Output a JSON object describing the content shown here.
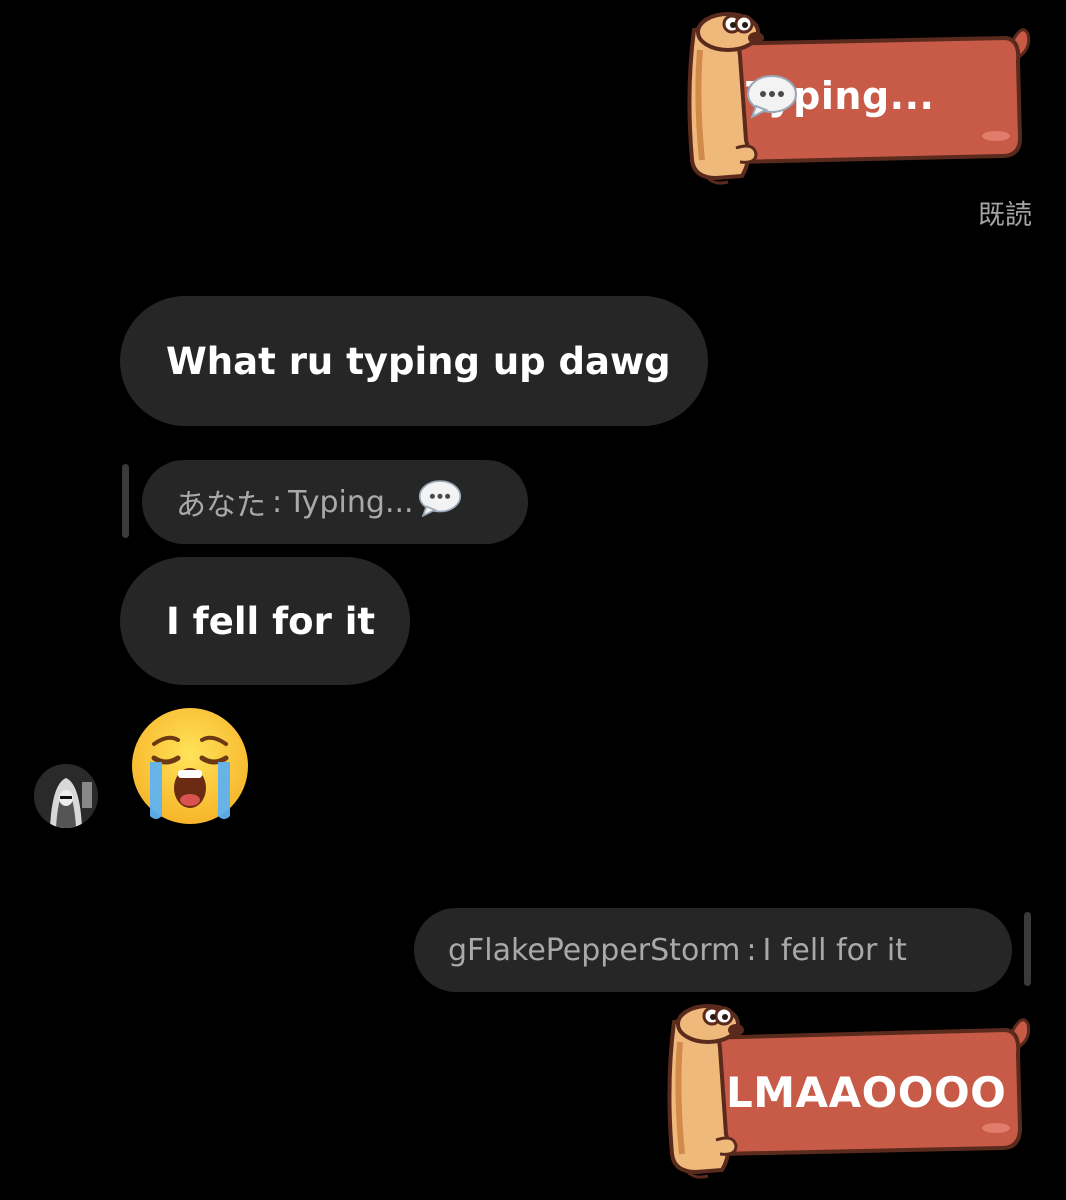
{
  "colors": {
    "background": "#000000",
    "incoming_bubble": "#262626",
    "sticker_red": "#c85a48",
    "sticker_dog": "#f0b97c",
    "muted_text": "#a9a9a9"
  },
  "messages": {
    "sticker_top": {
      "text": "Typing... ",
      "icon": "speech-bubble-icon"
    },
    "read_receipt": "既読",
    "incoming_1": "What ru typing up dawg",
    "reply_quote_1": {
      "author": "あなた",
      "separator": ":",
      "text": "Typing... ",
      "icon": "speech-bubble-icon"
    },
    "incoming_2": "I fell for it",
    "incoming_3_emoji": "loudly-crying-face",
    "reply_quote_2": {
      "author": "gFlakePepperStorm",
      "separator": ":",
      "text": "I fell for it"
    },
    "sticker_bottom": {
      "text": "LMAAOOOO"
    }
  },
  "sender": {
    "avatar": "avatar-icon"
  }
}
